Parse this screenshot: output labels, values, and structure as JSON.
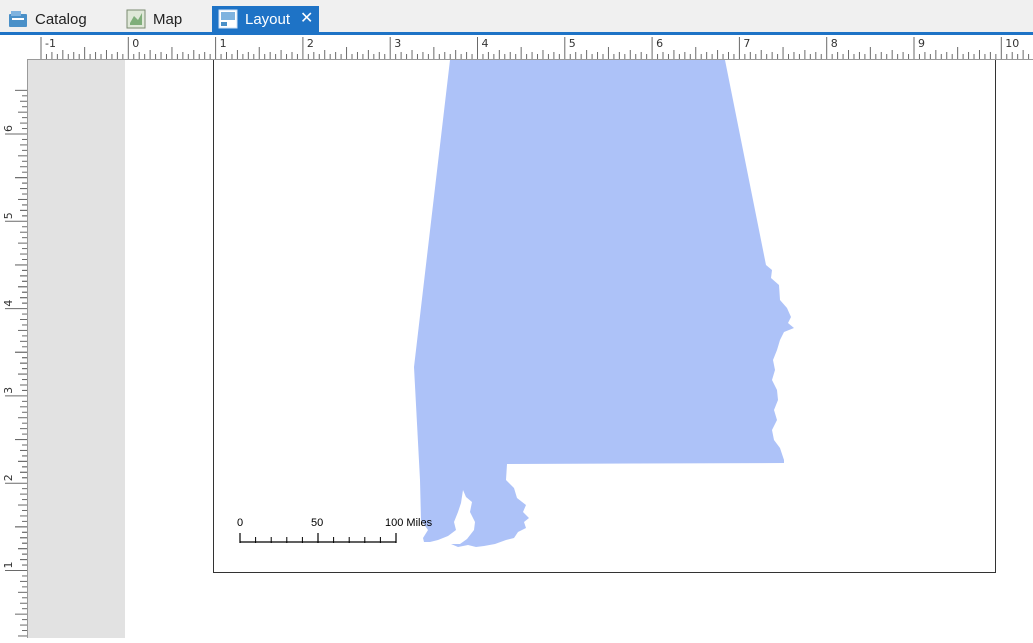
{
  "tabs": [
    {
      "label": "Catalog",
      "icon": "catalog-icon",
      "active": false
    },
    {
      "label": "Map",
      "icon": "map-icon",
      "active": false
    },
    {
      "label": "Layout",
      "icon": "layout-icon",
      "active": true
    }
  ],
  "close_symbol": "✕",
  "ruler": {
    "horizontal_labels": [
      "-1",
      "0",
      "1",
      "2",
      "3",
      "4",
      "5",
      "6",
      "7",
      "8",
      "9",
      "10"
    ],
    "vertical_labels": [
      "6",
      "5",
      "4",
      "3",
      "2",
      "1"
    ]
  },
  "scalebar": {
    "labels": [
      "0",
      "50",
      "100 Miles"
    ]
  },
  "colors": {
    "accent": "#1e73c6",
    "state_fill": "#adc2f8",
    "page_gray": "#e2e2e2"
  }
}
